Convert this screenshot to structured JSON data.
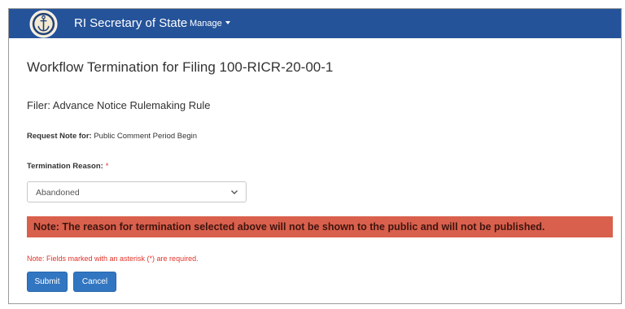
{
  "navbar": {
    "title": "RI Secretary of State",
    "manage_label": "Manage",
    "logo_icon": "anchor-seal-icon",
    "background_color": "#25539a"
  },
  "page": {
    "title": "Workflow Termination for Filing 100-RICR-20-00-1",
    "filer": "Filer: Advance Notice Rulemaking Rule",
    "request_note_label": "Request Note for:",
    "request_note_value": "Public Comment Period Begin"
  },
  "form": {
    "reason_label": "Termination Reason:",
    "required_marker": "*",
    "reason_selected": "Abandoned"
  },
  "alert": {
    "text": "Note: The reason for termination selected above will not be shown to the public and will not be published.",
    "background_color": "#d9604c"
  },
  "required_note": "Note: Fields marked with an asterisk (*) are required.",
  "buttons": {
    "submit_label": "Submit",
    "cancel_label": "Cancel",
    "color": "#3276c2"
  }
}
